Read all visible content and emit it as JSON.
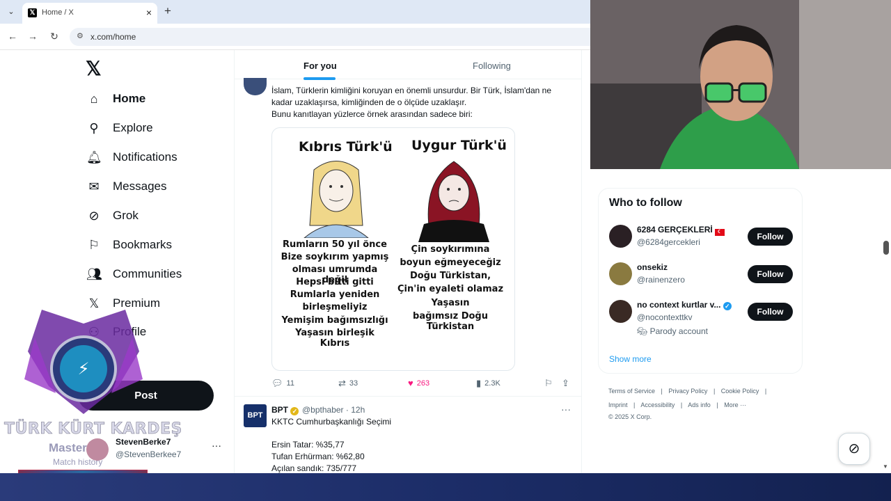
{
  "browser": {
    "tab_title": "Home / X",
    "new_tab": "+",
    "close": "×",
    "url": "x.com/home"
  },
  "nav": {
    "items": [
      {
        "label": "Home",
        "icon": "home-icon"
      },
      {
        "label": "Explore",
        "icon": "search-icon"
      },
      {
        "label": "Notifications",
        "icon": "bell-icon"
      },
      {
        "label": "Messages",
        "icon": "envelope-icon"
      },
      {
        "label": "Grok",
        "icon": "grok-icon"
      },
      {
        "label": "Bookmarks",
        "icon": "bookmark-icon"
      },
      {
        "label": "Communities",
        "icon": "people-icon"
      },
      {
        "label": "Premium",
        "icon": "x-icon"
      },
      {
        "label": "Profile",
        "icon": "person-icon"
      }
    ],
    "post_label": "Post",
    "account_name": "StevenBerke7",
    "account_handle": "@StevenBerkee7",
    "more": "···"
  },
  "overlay": {
    "title": "TÜRK KÜRT KARDEŞ",
    "rank": "Master",
    "sub": "Match history"
  },
  "feed": {
    "tabs": [
      "For you",
      "Following"
    ],
    "tweet1": {
      "line1": "İslam, Türklerin kimliğini koruyan en önemli unsurdur. Bir Türk, İslam'dan ne",
      "line2": "kadar uzaklaşırsa, kimliğinden de o ölçüde uzaklaşır.",
      "line3": "Bunu kanıtlayan yüzlerce örnek arasından sadece biri:",
      "meme": {
        "left_heading": "Kıbrıs Türk'ü",
        "right_heading": "Uygur Türk'ü",
        "left_lines": [
          "Rumların 50 yıl önce",
          "Bize soykırım yapmış",
          "olması umrumda değil",
          "Hepsi bitti gitti",
          "Rumlarla yeniden",
          "birleşmeliyiz",
          "Yemişim bağımsızlığı",
          "Yaşasın birleşik Kıbrıs"
        ],
        "right_lines": [
          "Çin soykırımına",
          "boyun eğmeyeceğiz",
          "Doğu Türkistan,",
          "Çin'in eyaleti olamaz",
          "Yaşasın",
          "bağımsız Doğu Türkistan"
        ]
      },
      "replies": "11",
      "reposts": "33",
      "likes": "263",
      "views": "2.3K"
    },
    "tweet2": {
      "avatar_text": "BPT",
      "name": "BPT",
      "handle_time": "@bpthaber · 12h",
      "more": "···",
      "lines": [
        "KKTC Cumhurbaşkanlığı Seçimi",
        "",
        "Ersin Tatar: %35,77",
        "Tufan Erhürman: %62,80",
        "Açılan sandık: 735/777"
      ]
    }
  },
  "who_to_follow": {
    "title": "Who to follow",
    "accounts": [
      {
        "name": "6284 GERÇEKLERİ",
        "handle": "@6284gercekleri",
        "note": "",
        "button": "Follow"
      },
      {
        "name": "onsekiz",
        "handle": "@rainenzero",
        "note": "",
        "button": "Follow"
      },
      {
        "name": "no context kurtlar v...",
        "handle": "@nocontexttkv",
        "note": "Parody account",
        "button": "Follow"
      }
    ],
    "show_more": "Show more"
  },
  "footer": {
    "row1": [
      "Terms of Service",
      "|",
      "Privacy Policy",
      "|",
      "Cookie Policy",
      "|"
    ],
    "row2": [
      "Imprint",
      "|",
      "Accessibility",
      "|",
      "Ads info",
      "|",
      "More ···"
    ],
    "copyright": "© 2025 X Corp."
  },
  "colors": {
    "accent": "#1d9bf0",
    "like": "#f91880",
    "text": "#0f1419",
    "muted": "#536471"
  }
}
